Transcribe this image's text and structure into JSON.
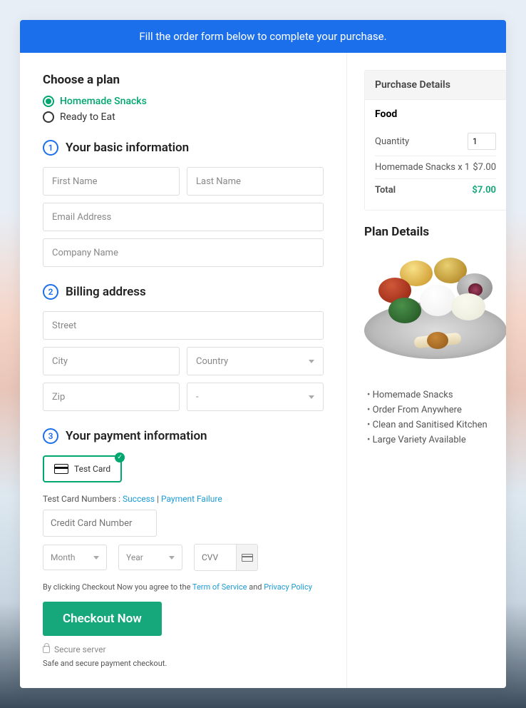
{
  "banner": "Fill the order form below to complete your purchase.",
  "plan": {
    "title": "Choose a plan",
    "opt1": "Homemade Snacks",
    "opt2": "Ready to Eat"
  },
  "sec1": {
    "num": "1",
    "title": "Your basic information"
  },
  "sec2": {
    "num": "2",
    "title": "Billing address"
  },
  "sec3": {
    "num": "3",
    "title": "Your payment information"
  },
  "ph": {
    "first": "First Name",
    "last": "Last Name",
    "email": "Email Address",
    "company": "Company Name",
    "street": "Street",
    "city": "City",
    "zip": "Zip",
    "cc": "Credit Card Number",
    "cvv": "CVV"
  },
  "sel": {
    "country": "Country",
    "state": "-",
    "month": "Month",
    "year": "Year"
  },
  "pay": {
    "cardbtn": "Test  Card",
    "notePrefix": "Test Card Numbers : ",
    "success": "Success",
    "sep": " | ",
    "failure": "Payment Failure"
  },
  "tos": {
    "prefix": "By clicking Checkout Now you agree to the ",
    "term": "Term of Service",
    "and": " and ",
    "privacy": "Privacy Policy"
  },
  "checkout": "Checkout Now",
  "secure": "Secure server",
  "safe": "Safe and secure payment checkout.",
  "purchase": {
    "head": "Purchase Details",
    "sub": "Food",
    "qtyLabel": "Quantity",
    "qtyVal": "1",
    "line": "Homemade Snacks x 1",
    "lineAmt": "$7.00",
    "totalLabel": "Total",
    "totalAmt": "$7.00"
  },
  "details": {
    "title": "Plan Details",
    "b1": "Homemade Snacks",
    "b2": "Order From Anywhere",
    "b3": "Clean and Sanitised Kitchen",
    "b4": "Large Variety Available"
  }
}
